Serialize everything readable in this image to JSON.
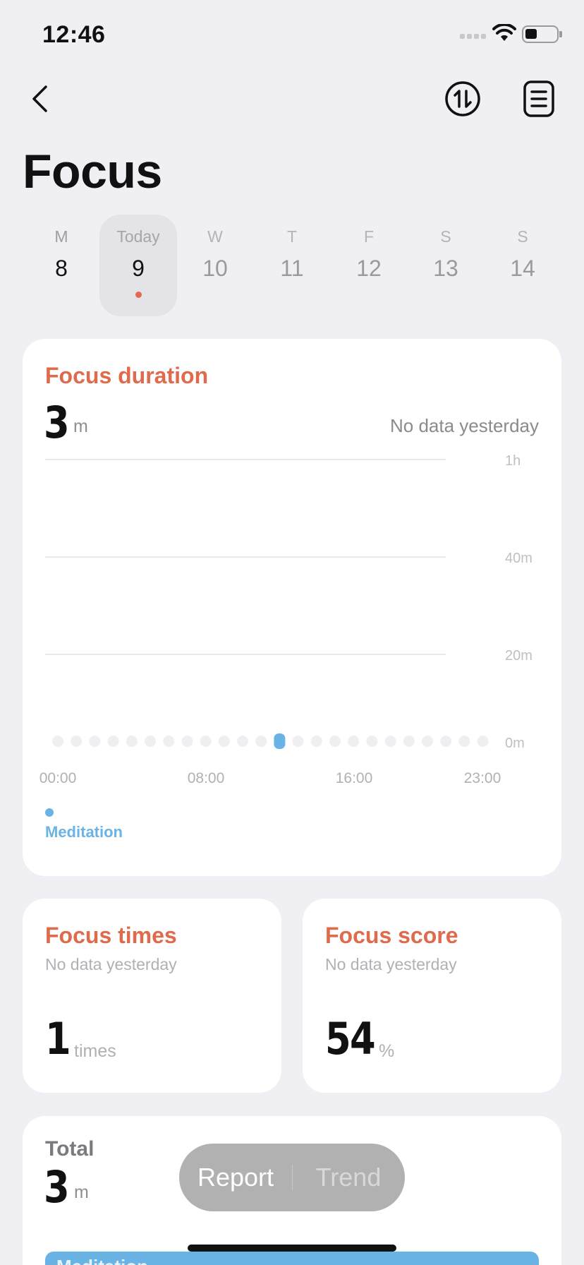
{
  "status_bar": {
    "time": "12:46"
  },
  "page": {
    "title": "Focus"
  },
  "week": [
    {
      "name": "M",
      "num": "8",
      "state": "past"
    },
    {
      "name": "Today",
      "num": "9",
      "state": "today"
    },
    {
      "name": "W",
      "num": "10",
      "state": "future"
    },
    {
      "name": "T",
      "num": "11",
      "state": "future"
    },
    {
      "name": "F",
      "num": "12",
      "state": "future"
    },
    {
      "name": "S",
      "num": "13",
      "state": "future"
    },
    {
      "name": "S",
      "num": "14",
      "state": "future"
    }
  ],
  "duration": {
    "title": "Focus duration",
    "value": "3",
    "unit": "m",
    "comparison": "No data yesterday",
    "legend": "Meditation"
  },
  "chart_data": {
    "type": "bar",
    "ytick_labels": [
      "1h",
      "40m",
      "20m",
      "0m"
    ],
    "xtick_labels": [
      "00:00",
      "08:00",
      "16:00",
      "23:00"
    ],
    "ylim_minutes": [
      0,
      60
    ],
    "grid": true,
    "series": [
      {
        "name": "Meditation",
        "color": "#6ab4e5",
        "hours": [
          0,
          1,
          2,
          3,
          4,
          5,
          6,
          7,
          8,
          9,
          10,
          11,
          12,
          13,
          14,
          15,
          16,
          17,
          18,
          19,
          20,
          21,
          22,
          23
        ],
        "minutes": [
          0,
          0,
          0,
          0,
          0,
          0,
          0,
          0,
          0,
          0,
          0,
          0,
          3,
          0,
          0,
          0,
          0,
          0,
          0,
          0,
          0,
          0,
          0,
          0
        ]
      }
    ]
  },
  "times": {
    "title": "Focus times",
    "comparison": "No data yesterday",
    "value": "1",
    "unit": "times"
  },
  "score": {
    "title": "Focus score",
    "comparison": "No data yesterday",
    "value": "54",
    "unit": "%"
  },
  "total": {
    "label": "Total",
    "value": "3",
    "unit": "m",
    "bar_label": "Meditation"
  },
  "tabs": {
    "report": "Report",
    "trend": "Trend"
  },
  "colors": {
    "accent": "#e06a4c",
    "meditation": "#6ab4e5",
    "background": "#f0eff4"
  }
}
